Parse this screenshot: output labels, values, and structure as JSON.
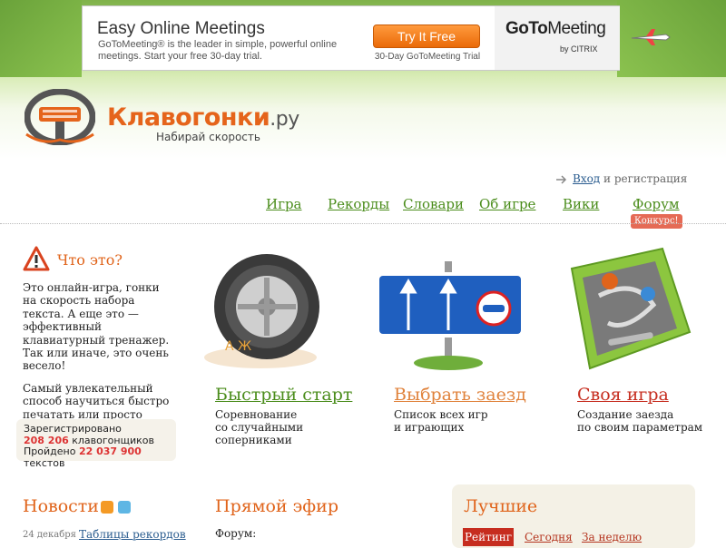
{
  "ad": {
    "title": "Easy Online Meetings",
    "text": "GoToMeeting® is the leader in simple, powerful online meetings. Start your free 30-day trial.",
    "button": "Try It Free",
    "trial": "30-Day GoToMeeting Trial",
    "brand_goto": "GoTo",
    "brand_meeting": "Meeting",
    "brand_by": "by CITRIX"
  },
  "logo": {
    "name": "Клавогонки",
    "suffix": ".ру",
    "tagline": "Набирай скорость"
  },
  "login": {
    "link": "Вход",
    "rest": " и регистрация"
  },
  "nav": {
    "items": [
      "Игра",
      "Рекорды",
      "Словари",
      "Об игре",
      "Вики",
      "Форум"
    ],
    "badge": "Конкурс!"
  },
  "about": {
    "title": "Что это?",
    "p1": "Это онлайн-игра, гонки на скорость набора текста. А еще это — эффективный клавиатурный тренажер. Так или иначе, это очень весело!",
    "p2": "Самый увлекательный способ научиться быстро печатать или просто интересно и с пользой"
  },
  "stats": {
    "registered_label": "Зарегистрировано",
    "racers_count": "208 206",
    "racers_label": " клавогонщиков",
    "passed_label": "Пройдено ",
    "texts_count": "22 037 900",
    "texts_label": " текстов"
  },
  "features": [
    {
      "title": "Быстрый старт",
      "desc1": "Соревнование",
      "desc2": "со случайными",
      "desc3": "соперниками",
      "color": "#4b8d1c"
    },
    {
      "title": "Выбрать заезд",
      "desc1": "Список всех игр",
      "desc2": "и играющих",
      "desc3": "",
      "color": "#e0823b"
    },
    {
      "title": "Своя игра",
      "desc1": "Создание заезда",
      "desc2": "по своим параметрам",
      "desc3": "",
      "color": "#c62d1f"
    }
  ],
  "news": {
    "title": "Новости",
    "date": "24 декабря",
    "link": "Таблицы рекордов"
  },
  "live": {
    "title": "Прямой эфир",
    "forum_label": "Форум:"
  },
  "best": {
    "title": "Лучшие",
    "tabs": [
      "Рейтинг",
      "Сегодня",
      "За неделю"
    ]
  },
  "colors": {
    "orange": "#e0641b",
    "green_link": "#4b8d1c",
    "red": "#c62d1f"
  }
}
